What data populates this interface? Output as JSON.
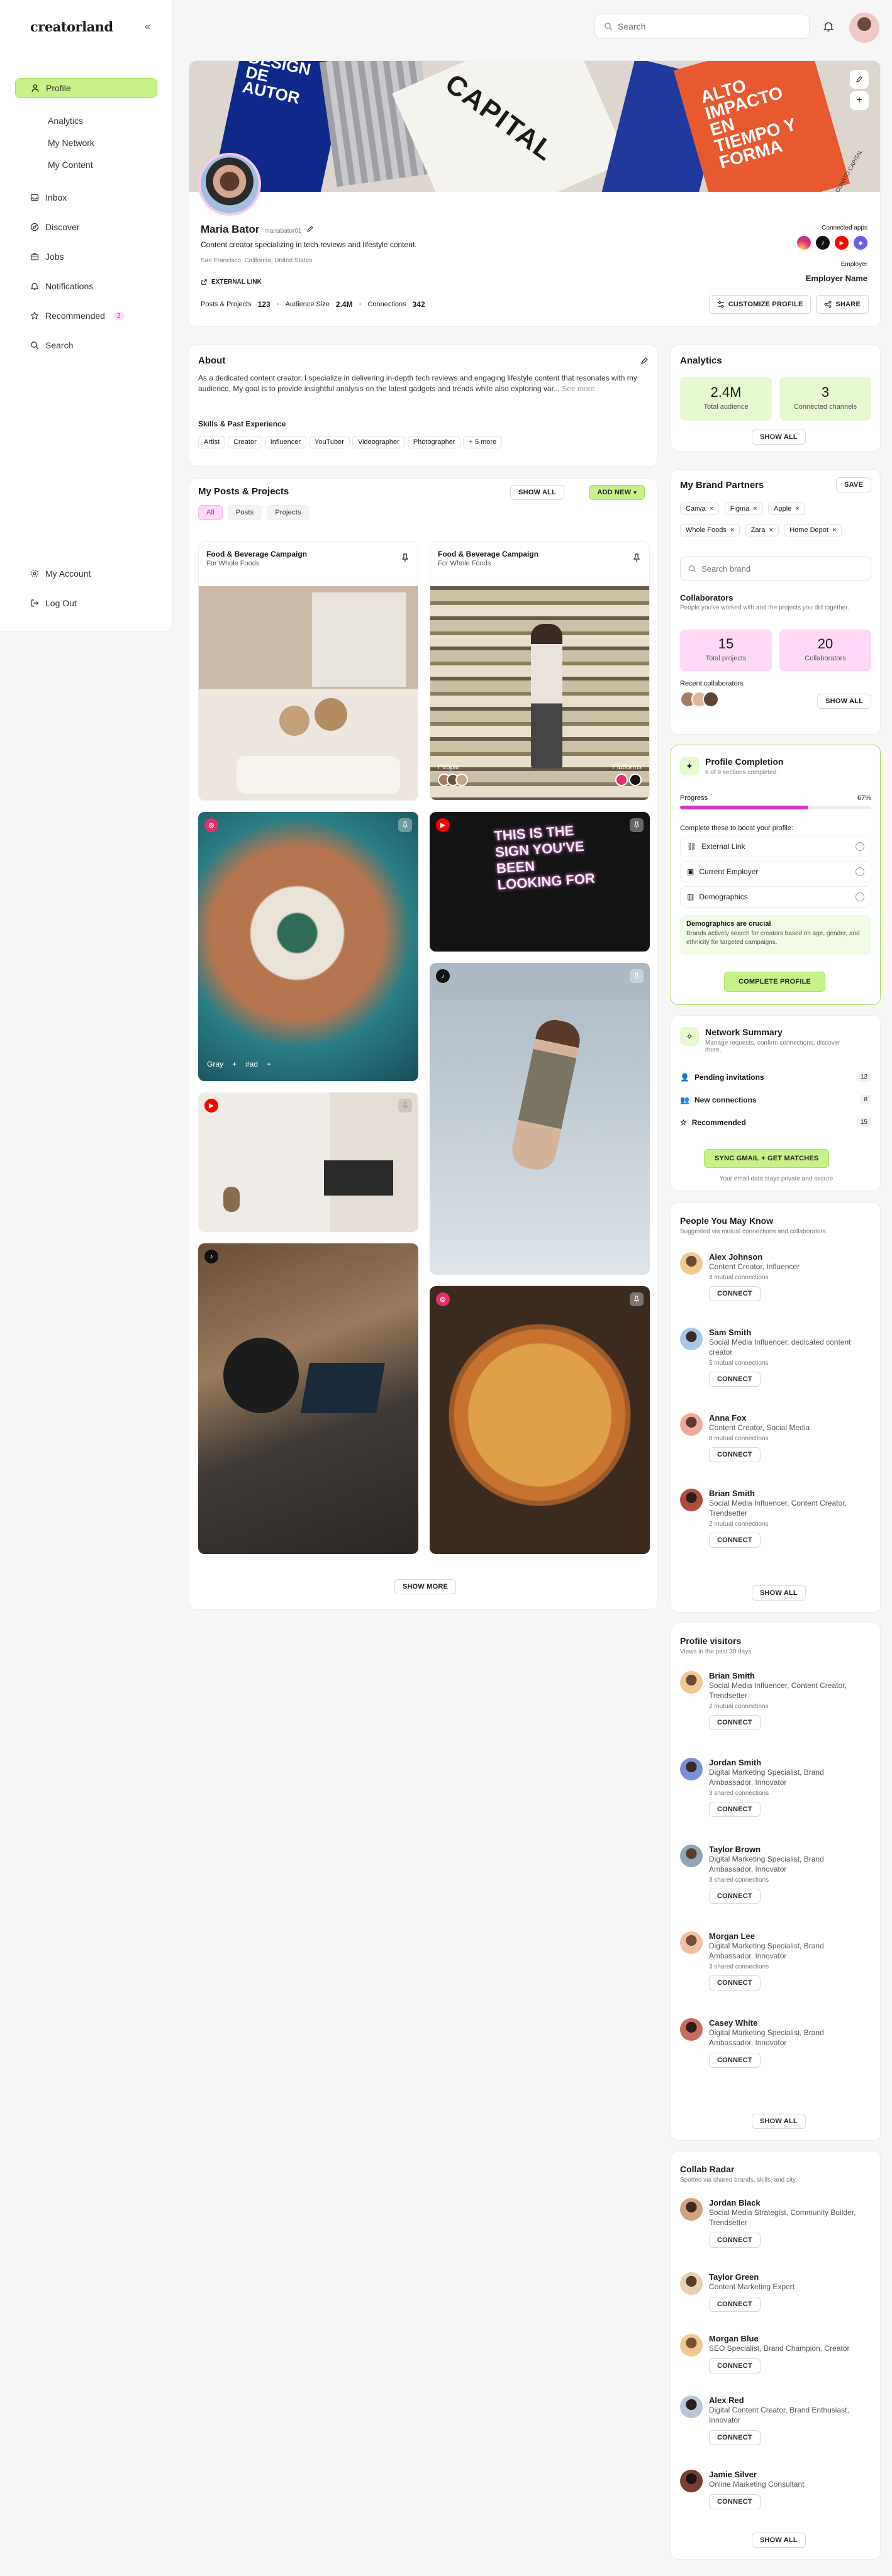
{
  "brand": {
    "logo": "creatorland"
  },
  "search": {
    "placeholder": "Search"
  },
  "sidebar": {
    "items": [
      {
        "label": "Profile"
      },
      {
        "label": "Inbox"
      },
      {
        "label": "Discover"
      },
      {
        "label": "Jobs"
      },
      {
        "label": "Notifications"
      },
      {
        "label": "Recommended",
        "badge": "2"
      },
      {
        "label": "Search"
      }
    ],
    "profile_sub": [
      "Analytics",
      "My Network",
      "My Content"
    ],
    "bottom": [
      {
        "label": "My Account"
      },
      {
        "label": "Log Out"
      }
    ]
  },
  "profile": {
    "name": "Maria Bator",
    "handle": "mariabator01",
    "bio": "Content creator specializing in tech reviews and lifestyle content.",
    "location": "San Francisco, California, United States",
    "external_link": "EXTERNAL LINK",
    "stats": [
      {
        "label": "Posts & Projects",
        "value": "123"
      },
      {
        "label": "Audience Size",
        "value": "2.4M"
      },
      {
        "label": "Connections",
        "value": "342"
      }
    ],
    "connected_apps_label": "Connected apps",
    "employer_label": "Employer",
    "employer_name": "Employer Name",
    "customize_label": "CUSTOMIZE PROFILE",
    "share_label": "SHARE",
    "banner_texts": [
      "DESIGN DE AUTOR",
      "CAPITAL",
      "ALTO IMPACTO EN TIEMPO Y FORMA",
      "CUARTO CAPITAL"
    ]
  },
  "about": {
    "title": "About",
    "text": "As a dedicated content creator, I specialize in delivering in-depth tech reviews and engaging lifestyle content that resonates with my audience. My goal is to provide insightful analysis on the latest gadgets and trends while also exploring var...",
    "see_more": "See more",
    "skills_title": "Skills & Past Experience",
    "skills": [
      "Artist",
      "Creator",
      "Influencer",
      "YouTuber",
      "Videographer",
      "Photographer",
      "+ 5 more"
    ]
  },
  "posts": {
    "title": "My Posts & Projects",
    "show_all": "SHOW ALL",
    "add_new": "ADD NEW",
    "tabs": [
      "All",
      "Posts",
      "Projects"
    ],
    "campaign_title": "Food & Beverage Campaign",
    "campaign_sub": "For Whole Foods",
    "people_label": "People",
    "platforms_label": "Platforms",
    "tags": [
      "Gray",
      "#ad"
    ],
    "neon_text": "THIS IS THE SIGN YOU'VE BEEN LOOKING FOR",
    "show_more": "SHOW MORE"
  },
  "analytics": {
    "title": "Analytics",
    "cards": [
      {
        "value": "2.4M",
        "label": "Total audience"
      },
      {
        "value": "3",
        "label": "Connected channels"
      }
    ],
    "show_all": "SHOW ALL"
  },
  "brand_partners": {
    "title": "My Brand Partners",
    "save": "SAVE",
    "brands": [
      "Canva",
      "Figma",
      "Apple",
      "Whole Foods",
      "Zara",
      "Home Depot"
    ],
    "search_placeholder": "Search brand",
    "collab_title": "Collaborators",
    "collab_sub": "People you've worked with and the projects you did together.",
    "collab_stats": [
      {
        "value": "15",
        "label": "Total projects"
      },
      {
        "value": "20",
        "label": "Collaborators"
      }
    ],
    "recent_label": "Recent collaborators",
    "show_all": "SHOW ALL"
  },
  "completion": {
    "title": "Profile Completion",
    "sub": "6 of 9 sections completed",
    "progress_label": "Progress",
    "progress_text": "67%",
    "progress": 0.67,
    "boost_label": "Complete these to boost your profile:",
    "items": [
      "External Link",
      "Current Employer",
      "Demographics"
    ],
    "note_title": "Demographics are crucial",
    "note_text": "Brands actively search for creators based on age, gender, and ethnicity for targeted campaigns.",
    "button": "COMPLETE PROFILE"
  },
  "network": {
    "title": "Network Summary",
    "sub": "Manage requests, confirm connections, discover more.",
    "rows": [
      {
        "label": "Pending invitations",
        "value": "12"
      },
      {
        "label": "New connections",
        "value": "8"
      },
      {
        "label": "Recommended",
        "value": "15"
      }
    ],
    "button": "SYNC GMAIL + GET MATCHES",
    "footnote": "Your email data stays private and secure"
  },
  "pymk": {
    "title": "People You May Know",
    "sub": "Suggested via mutual connections and collaborators.",
    "connect": "CONNECT",
    "show_all": "SHOW ALL",
    "people": [
      {
        "name": "Alex Johnson",
        "desc": "Content Creator, Influencer",
        "mutual": "4 mutual connections"
      },
      {
        "name": "Sam Smith",
        "desc": "Social Media Influencer, dedicated content creator",
        "mutual": "5 mutual connections"
      },
      {
        "name": "Anna Fox",
        "desc": "Content Creator, Social Media",
        "mutual": "8 mutual connections"
      },
      {
        "name": "Brian Smith",
        "desc": "Social Media Influencer, Content Creator, Trendsetter",
        "mutual": "2 mutual connections"
      }
    ]
  },
  "visitors": {
    "title": "Profile visitors",
    "sub": "Views in the past 30 days.",
    "connect": "CONNECT",
    "show_all": "SHOW ALL",
    "people": [
      {
        "name": "Brian Smith",
        "desc": "Social Media Influencer, Content Creator, Trendsetter",
        "mutual": "2 mutual connections"
      },
      {
        "name": "Jordan Smith",
        "desc": "Digital Marketing Specialist, Brand Ambassador, Innovator",
        "mutual": "3 shared connections"
      },
      {
        "name": "Taylor Brown",
        "desc": "Digital Marketing Specialist, Brand Ambassador, Innovator",
        "mutual": "3 shared connections"
      },
      {
        "name": "Morgan Lee",
        "desc": "Digital Marketing Specialist, Brand Ambassador, Innovator",
        "mutual": "3 shared connections"
      },
      {
        "name": "Casey White",
        "desc": "Digital Marketing Specialist, Brand Ambassador, Innovator",
        "mutual": "3 shared connections"
      }
    ]
  },
  "radar": {
    "title": "Collab Radar",
    "sub": "Spotted via shared brands, skills, and city.",
    "connect": "CONNECT",
    "show_all": "SHOW ALL",
    "people": [
      {
        "name": "Jordan Black",
        "desc": "Social Media Strategist, Community Builder, Trendsetter"
      },
      {
        "name": "Taylor Green",
        "desc": "Content Marketing Expert"
      },
      {
        "name": "Morgan Blue",
        "desc": "SEO Specialist, Brand Champion, Creator"
      },
      {
        "name": "Alex Red",
        "desc": "Digital Content Creator, Brand Enthusiast, Innovator"
      },
      {
        "name": "Jamie Silver",
        "desc": "Online Marketing Consultant"
      }
    ]
  },
  "colors": {
    "accent_green": "#c6f28a",
    "accent_pink": "#ffd9f6",
    "progress": "#d633c8",
    "instagram": "#e1306c",
    "tiktok": "#111111",
    "youtube": "#ff0000"
  }
}
